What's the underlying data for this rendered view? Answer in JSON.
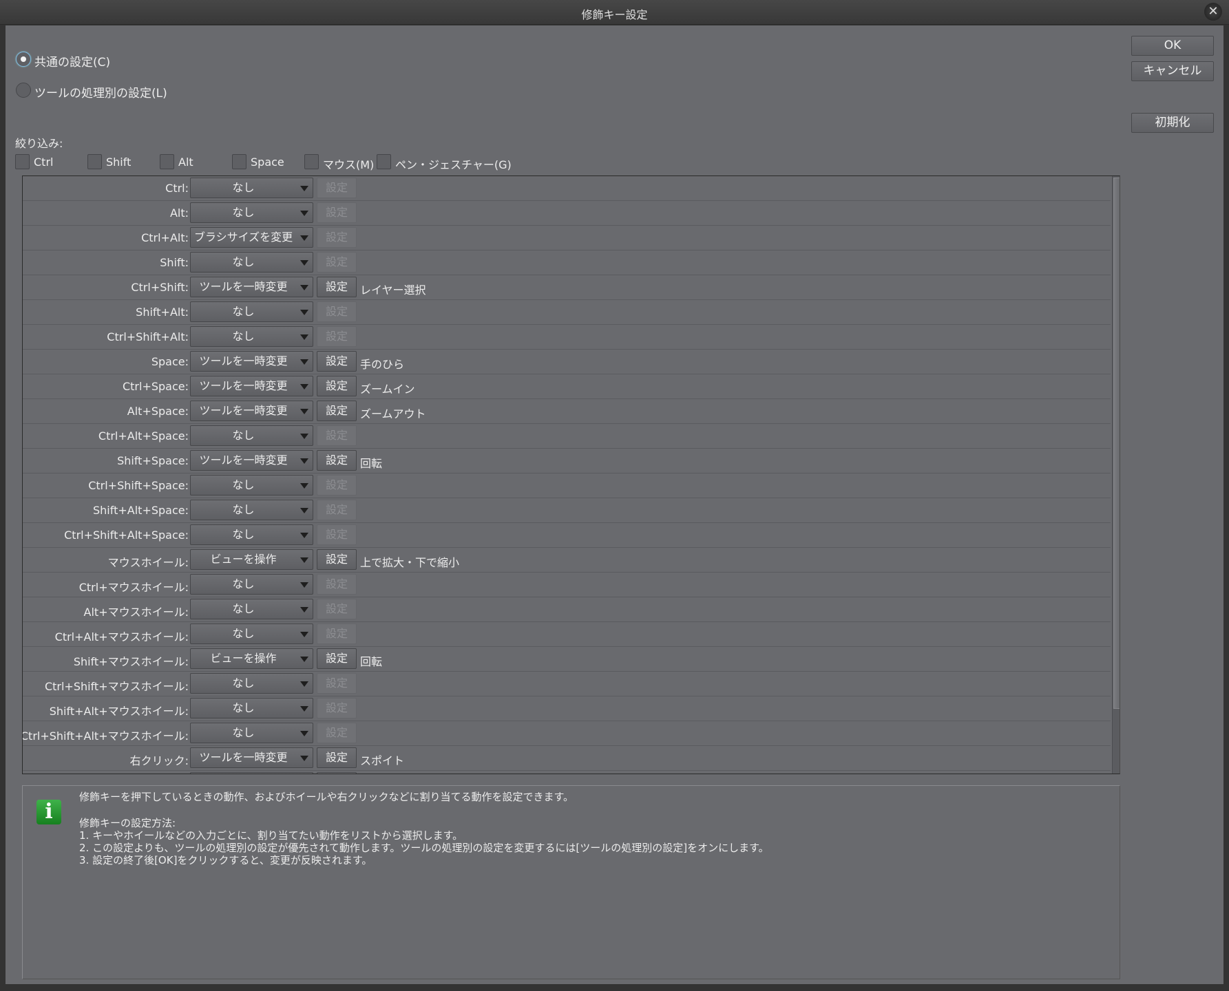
{
  "window": {
    "title": "修飾キー設定",
    "close": "✕"
  },
  "buttons": {
    "ok": "OK",
    "cancel": "キャンセル",
    "reset": "初期化"
  },
  "mode": {
    "common": "共通の設定(C)",
    "per_tool": "ツールの処理別の設定(L)",
    "selected": "common"
  },
  "filter": {
    "label": "絞り込み:",
    "options": [
      "Ctrl",
      "Shift",
      "Alt",
      "Space",
      "マウス(M)",
      "ペン・ジェスチャー(G)"
    ]
  },
  "set_label": "設定",
  "rows": [
    {
      "key": "Ctrl:",
      "action": "なし",
      "enabled": false,
      "result": ""
    },
    {
      "key": "Alt:",
      "action": "なし",
      "enabled": false,
      "result": ""
    },
    {
      "key": "Ctrl+Alt:",
      "action": "ブラシサイズを変更",
      "enabled": false,
      "result": ""
    },
    {
      "key": "Shift:",
      "action": "なし",
      "enabled": false,
      "result": ""
    },
    {
      "key": "Ctrl+Shift:",
      "action": "ツールを一時変更",
      "enabled": true,
      "result": "レイヤー選択"
    },
    {
      "key": "Shift+Alt:",
      "action": "なし",
      "enabled": false,
      "result": ""
    },
    {
      "key": "Ctrl+Shift+Alt:",
      "action": "なし",
      "enabled": false,
      "result": ""
    },
    {
      "key": "Space:",
      "action": "ツールを一時変更",
      "enabled": true,
      "result": "手のひら"
    },
    {
      "key": "Ctrl+Space:",
      "action": "ツールを一時変更",
      "enabled": true,
      "result": "ズームイン"
    },
    {
      "key": "Alt+Space:",
      "action": "ツールを一時変更",
      "enabled": true,
      "result": "ズームアウト"
    },
    {
      "key": "Ctrl+Alt+Space:",
      "action": "なし",
      "enabled": false,
      "result": ""
    },
    {
      "key": "Shift+Space:",
      "action": "ツールを一時変更",
      "enabled": true,
      "result": "回転"
    },
    {
      "key": "Ctrl+Shift+Space:",
      "action": "なし",
      "enabled": false,
      "result": ""
    },
    {
      "key": "Shift+Alt+Space:",
      "action": "なし",
      "enabled": false,
      "result": ""
    },
    {
      "key": "Ctrl+Shift+Alt+Space:",
      "action": "なし",
      "enabled": false,
      "result": ""
    },
    {
      "key": "マウスホイール:",
      "action": "ビューを操作",
      "enabled": true,
      "result": "上で拡大・下で縮小"
    },
    {
      "key": "Ctrl+マウスホイール:",
      "action": "なし",
      "enabled": false,
      "result": ""
    },
    {
      "key": "Alt+マウスホイール:",
      "action": "なし",
      "enabled": false,
      "result": ""
    },
    {
      "key": "Ctrl+Alt+マウスホイール:",
      "action": "なし",
      "enabled": false,
      "result": ""
    },
    {
      "key": "Shift+マウスホイール:",
      "action": "ビューを操作",
      "enabled": true,
      "result": "回転"
    },
    {
      "key": "Ctrl+Shift+マウスホイール:",
      "action": "なし",
      "enabled": false,
      "result": ""
    },
    {
      "key": "Shift+Alt+マウスホイール:",
      "action": "なし",
      "enabled": false,
      "result": ""
    },
    {
      "key": "Ctrl+Shift+Alt+マウスホイール:",
      "action": "なし",
      "enabled": false,
      "result": ""
    },
    {
      "key": "右クリック:",
      "action": "ツールを一時変更",
      "enabled": true,
      "result": "スポイト"
    }
  ],
  "info": {
    "icon": "info-icon",
    "lines": [
      "修飾キーを押下しているときの動作、およびホイールや右クリックなどに割り当てる動作を設定できます。",
      "修飾キーの設定方法:",
      "1. キーやホイールなどの入力ごとに、割り当てたい動作をリストから選択します。",
      "2. この設定よりも、ツールの処理別の設定が優先されて動作します。ツールの処理別の設定を変更するには[ツールの処理別の設定]をオンにします。",
      "3. 設定の終了後[OK]をクリックすると、変更が反映されます。"
    ]
  }
}
